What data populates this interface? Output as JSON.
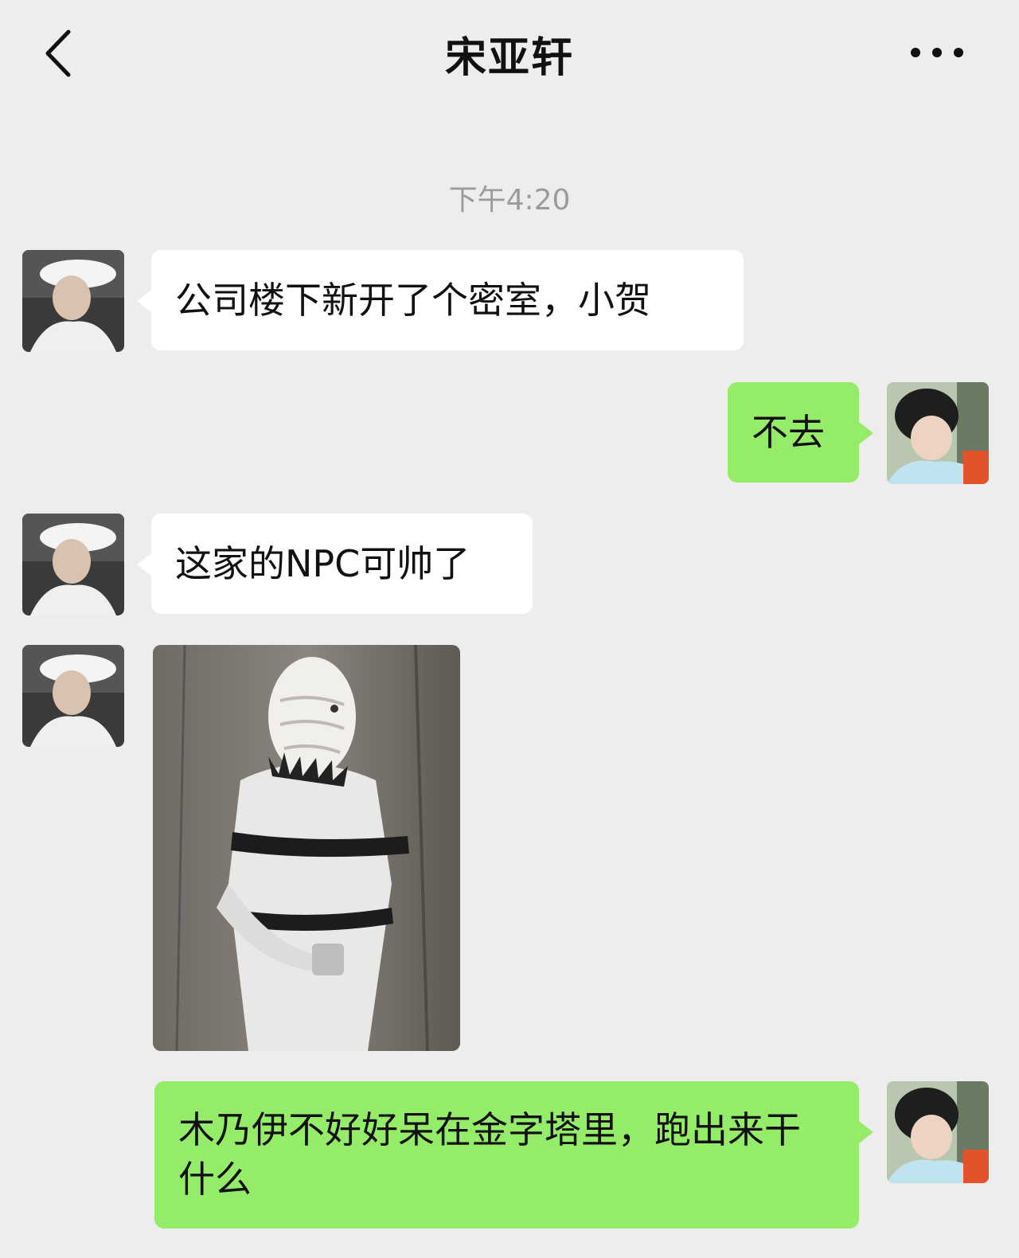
{
  "header": {
    "title": "宋亚轩",
    "back_icon": "chevron-left-icon",
    "more_icon": "more-dots-icon"
  },
  "timestamp": "下午4:20",
  "messages": [
    {
      "side": "left",
      "type": "text",
      "text": "公司楼下新开了个密室，小贺"
    },
    {
      "side": "right",
      "type": "text",
      "text": "不去"
    },
    {
      "side": "left",
      "type": "text",
      "text": "这家的NPC可帅了"
    },
    {
      "side": "left",
      "type": "image",
      "description_icon": "photo-icon"
    },
    {
      "side": "right",
      "type": "text",
      "text": "木乃伊不好好呆在金字塔里，跑出来干什么"
    }
  ],
  "colors": {
    "background": "#ededed",
    "incoming_bubble": "#ffffff",
    "outgoing_bubble": "#95ec69",
    "timestamp": "#9b9b9b"
  }
}
